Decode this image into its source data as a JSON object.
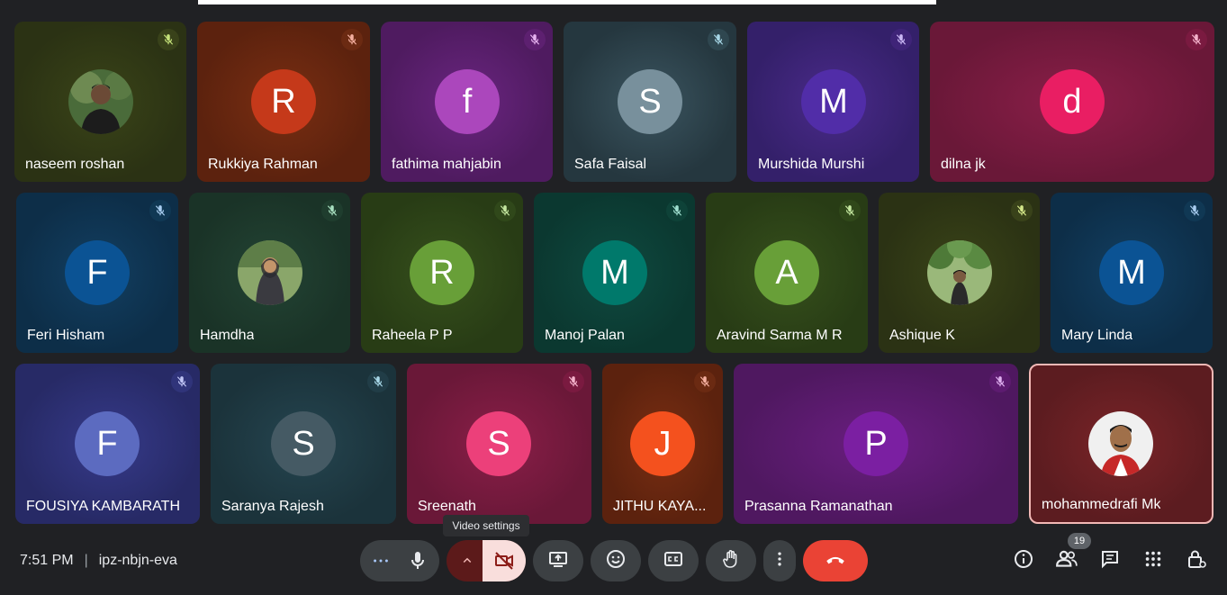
{
  "participants": [
    {
      "name": "naseem roshan"
    },
    {
      "name": "Rukkiya Rahman",
      "initial": "R"
    },
    {
      "name": "fathima mahjabin",
      "initial": "f"
    },
    {
      "name": "Safa Faisal",
      "initial": "S"
    },
    {
      "name": "Murshida Murshi",
      "initial": "M"
    },
    {
      "name": "dilna jk",
      "initial": "d"
    },
    {
      "name": "Feri Hisham",
      "initial": "F"
    },
    {
      "name": "Hamdha"
    },
    {
      "name": "Raheela P P",
      "initial": "R"
    },
    {
      "name": "Manoj Palan",
      "initial": "M"
    },
    {
      "name": "Aravind Sarma M R",
      "initial": "A"
    },
    {
      "name": "Ashique K"
    },
    {
      "name": "Mary Linda",
      "initial": "M"
    },
    {
      "name": "FOUSIYA KAMBARATH",
      "initial": "F"
    },
    {
      "name": "Saranya Rajesh",
      "initial": "S"
    },
    {
      "name": "Sreenath",
      "initial": "S"
    },
    {
      "name": "JITHU KAYA...",
      "initial": "J"
    },
    {
      "name": "Prasanna Ramanathan",
      "initial": "P"
    },
    {
      "name": "mohammedrafi Mk"
    }
  ],
  "colors": {
    "avatar_red": "#c5391a",
    "avatar_purple": "#ab47bc",
    "avatar_grey": "#78909c",
    "avatar_indigo": "#512da8",
    "avatar_pink": "#e91e63",
    "avatar_blue": "#0b5394",
    "avatar_green": "#689f38",
    "avatar_teal": "#00796b",
    "avatar_periwinkle": "#5c6bc0",
    "avatar_slate": "#455a64",
    "avatar_pink2": "#ec407a",
    "avatar_orange": "#f4511e",
    "avatar_violet": "#7b1fa2",
    "end_call": "#ea4335",
    "camera_off": "#f9dedc",
    "active_speaker_border": "#f2b8b5"
  },
  "meeting": {
    "time": "7:51 PM",
    "separator": "|",
    "code": "ipz-nbjn-eva"
  },
  "tooltip": "Video settings",
  "people_count": "19",
  "icons": {
    "more": "more-horiz-icon",
    "mic": "mic-icon",
    "chevron": "chevron-up-icon",
    "camera": "videocam-off-icon",
    "present": "present-icon",
    "emoji": "emoji-icon",
    "captions": "captions-icon",
    "hand": "raise-hand-icon",
    "more_vert": "more-vert-icon",
    "end": "call-end-icon",
    "info": "info-icon",
    "people": "people-icon",
    "chat": "chat-icon",
    "activities": "apps-icon",
    "lock": "host-controls-icon"
  }
}
